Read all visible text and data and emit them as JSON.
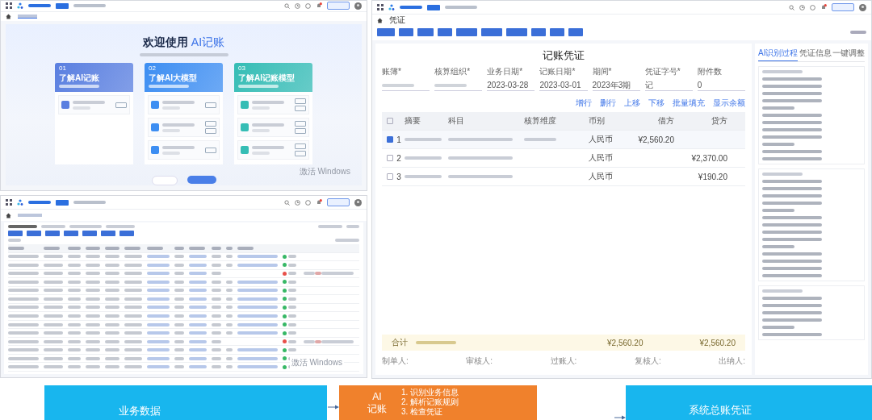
{
  "welcome_window": {
    "heading": "欢迎使用",
    "heading_accent": "AI记账",
    "cards": [
      {
        "number": "01",
        "title": "了解AI记账",
        "color": "#5a7fe0",
        "entries": [
          {
            "kind": "single"
          }
        ]
      },
      {
        "number": "02",
        "title": "了解AI大模型",
        "color": "#3d8ef2",
        "entries": [
          {
            "kind": "single"
          },
          {
            "kind": "double"
          },
          {
            "kind": "single"
          }
        ]
      },
      {
        "number": "03",
        "title": "了解AI记账模型",
        "color": "#35bdb5",
        "entries": [
          {
            "kind": "double"
          },
          {
            "kind": "double"
          },
          {
            "kind": "double"
          }
        ]
      }
    ],
    "watermark": "激活 Windows"
  },
  "list_window": {
    "rows": [
      {
        "kind": "done"
      },
      {
        "kind": "done"
      },
      {
        "kind": "failed"
      },
      {
        "kind": "done"
      },
      {
        "kind": "done"
      },
      {
        "kind": "done"
      },
      {
        "kind": "done"
      },
      {
        "kind": "done"
      },
      {
        "kind": "done"
      },
      {
        "kind": "done"
      },
      {
        "kind": "failed"
      },
      {
        "kind": "done"
      },
      {
        "kind": "done"
      },
      {
        "kind": "done"
      }
    ],
    "watermark": "激活 Windows"
  },
  "voucher_window": {
    "tab": "凭证",
    "title": "记账凭证",
    "fields": [
      {
        "label": "账簿*"
      },
      {
        "label": "核算组织*"
      },
      {
        "label": "业务日期*",
        "value": "2023-03-28"
      },
      {
        "label": "记账日期*",
        "value": "2023-03-01"
      },
      {
        "label": "期间*",
        "value": "2023年3期"
      },
      {
        "label": "凭证字号*",
        "value": "记"
      },
      {
        "label": "附件数",
        "value": "0"
      }
    ],
    "row_actions": [
      "增行",
      "删行",
      "上移",
      "下移",
      "批量填充",
      "显示余额"
    ],
    "columns": [
      "摘要",
      "科目",
      "核算维度",
      "币别",
      "借方",
      "贷方"
    ],
    "header_checked": false,
    "lines": [
      {
        "index": "1",
        "checked": true,
        "currency": "人民币",
        "debit": "¥2,560.20"
      },
      {
        "index": "2",
        "checked": false,
        "currency": "人民币",
        "credit": "¥2,370.00"
      },
      {
        "index": "3",
        "checked": false,
        "currency": "人民币",
        "credit": "¥190.20"
      }
    ],
    "total": {
      "label": "合计",
      "debit": "¥2,560.20",
      "credit": "¥2,560.20"
    },
    "signers": [
      "制单人:",
      "审核人:",
      "过账人:",
      "复核人:",
      "出纳人:"
    ],
    "panel_tabs": [
      {
        "label": "AI识别过程",
        "selected": true
      },
      {
        "label": "凭证信息",
        "selected": false
      },
      {
        "label": "一键调整",
        "selected": false
      }
    ]
  },
  "flow": [
    {
      "kind": "source",
      "label": "业务数据",
      "color": "#18b6ee"
    },
    {
      "kind": "process",
      "label": "AI",
      "label_2": "记账",
      "color": "#f0812c",
      "steps": [
        "1. 识别业务信息",
        "2. 解析记账规则",
        "3. 检查凭证"
      ]
    },
    {
      "kind": "result",
      "label": "系统总账凭证",
      "color": "#18b6ee"
    }
  ]
}
